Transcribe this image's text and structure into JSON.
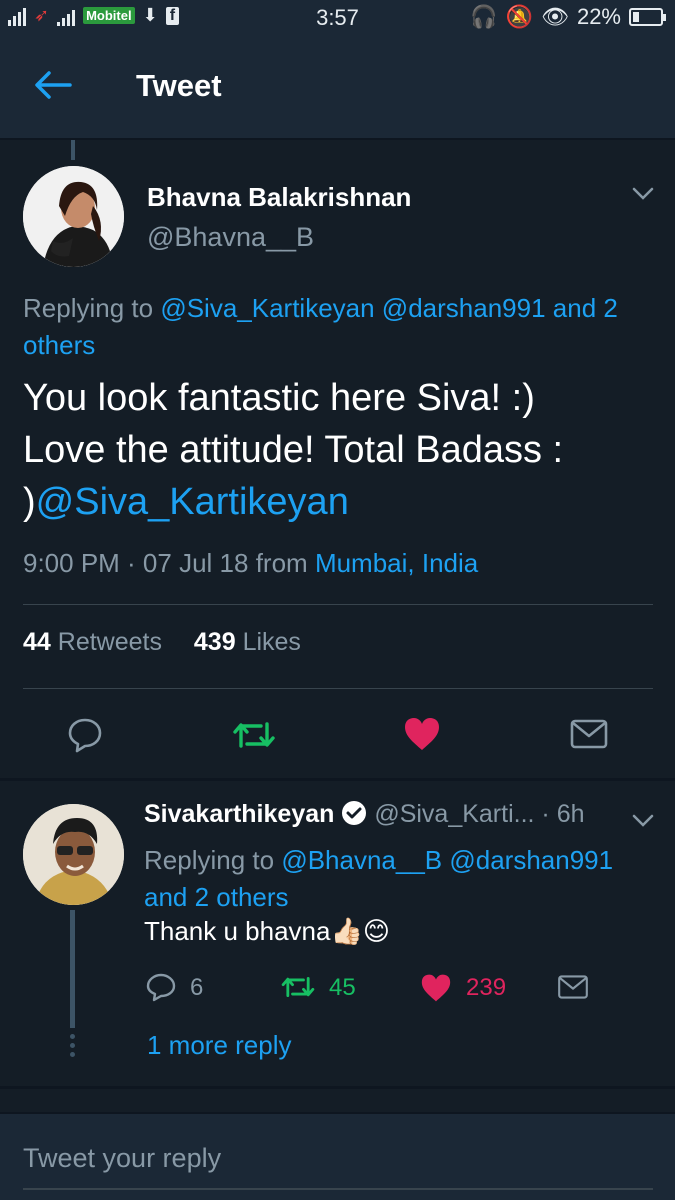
{
  "status_bar": {
    "carrier": "Mobitel",
    "time": "3:57",
    "battery": "22%",
    "battery_level": 0.22
  },
  "app_bar": {
    "title": "Tweet"
  },
  "tweet": {
    "author_name": "Bhavna Balakrishnan",
    "author_handle": "@Bhavna__B",
    "replying_prefix": "Replying to",
    "replying_mentions": "@Siva_Kartikeyan @darshan991",
    "replying_suffix": "and 2 others",
    "text_line1": "You look fantastic here Siva! :)",
    "text_line2": "Love the attitude! Total Badass :",
    "text_line3_prefix": ")",
    "text_mention": "@Siva_Kartikeyan",
    "timestamp": "9:00 PM · 07 Jul 18",
    "from_label": "from",
    "location": "Mumbai, India",
    "retweets_count": "44",
    "retweets_label": "Retweets",
    "likes_count": "439",
    "likes_label": "Likes"
  },
  "reply": {
    "author_name": "Sivakarthikeyan",
    "author_handle": "@Siva_Karti...",
    "time_ago": "· 6h",
    "replying_prefix": "Replying to",
    "replying_mentions": "@Bhavna__B @darshan991",
    "replying_suffix": "and 2 others",
    "text": "Thank u bhavna",
    "emoji": "👍🏻😊",
    "reply_count": "6",
    "retweet_count": "45",
    "like_count": "239",
    "more_replies": "1 more reply"
  },
  "compose": {
    "placeholder": "Tweet your reply"
  },
  "colors": {
    "background": "#141d26",
    "bar": "#1b2836",
    "accent": "#1da1f2",
    "retweet_green": "#17bf63",
    "like_red": "#e0245e",
    "muted": "#8899a6"
  }
}
